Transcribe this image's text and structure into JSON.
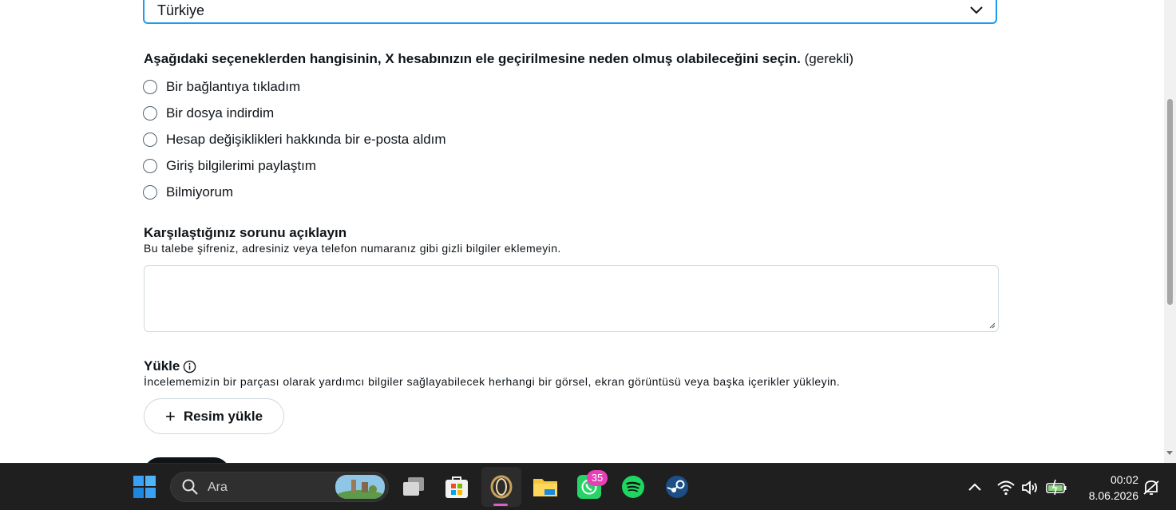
{
  "country_select": {
    "value": "Türkiye"
  },
  "question": {
    "text": "Aşağıdaki seçeneklerden hangisinin, X hesabınızın ele geçirilmesine neden olmuş olabileceğini seçin.",
    "required": "(gerekli)"
  },
  "options": [
    "Bir bağlantıya tıkladım",
    "Bir dosya indirdim",
    "Hesap değişiklikleri hakkında bir e-posta aldım",
    "Giriş bilgilerimi paylaştım",
    "Bilmiyorum"
  ],
  "describe": {
    "title": "Karşılaştığınız sorunu açıklayın",
    "hint": "Bu talebe şifreniz, adresiniz veya telefon numaranız gibi gizli bilgiler eklemeyin."
  },
  "upload": {
    "title": "Yükle",
    "hint": "İncelememizin bir parçası olarak yardımcı bilgiler sağlayabilecek herhangi bir görsel, ekran görüntüsü veya başka içerikler yükleyin.",
    "button_label": "Resim yükle"
  },
  "taskbar": {
    "search_placeholder": "Ara",
    "whatsapp_badge": "35",
    "apps": [
      "start-icon",
      "search-icon",
      "task-view-icon",
      "microsoft-store-icon",
      "opera-gx-icon",
      "file-explorer-icon",
      "whatsapp-icon",
      "spotify-icon",
      "steam-icon"
    ],
    "time": "00:02",
    "date": "8.06.2026"
  },
  "colors": {
    "accent": "#1d9bf0",
    "text": "#0f1419",
    "border": "#cfd9de",
    "taskbar": "#1f1f1f"
  }
}
